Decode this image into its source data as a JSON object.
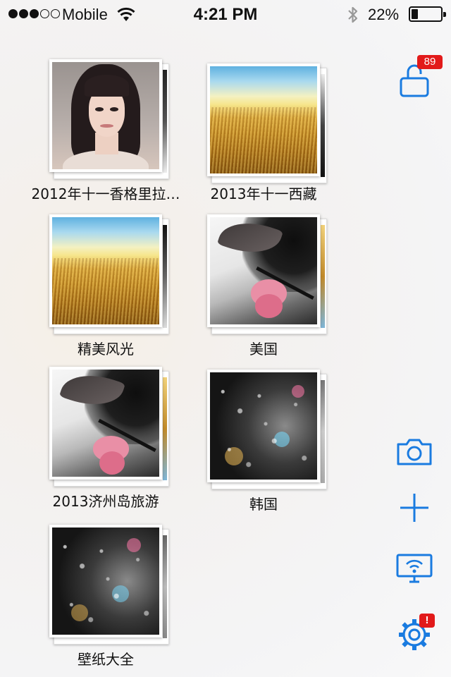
{
  "status_bar": {
    "carrier": "Mobile",
    "time": "4:21 PM",
    "battery_percent": "22%",
    "battery_level": 0.22,
    "signal_bars_filled": 3,
    "signal_bars_total": 5,
    "icons": [
      "wifi-icon",
      "bluetooth-icon",
      "battery-icon"
    ]
  },
  "albums": [
    {
      "title": "2012年十一香格里拉…",
      "cover": "portrait"
    },
    {
      "title": "2013年十一西藏",
      "cover": "wheat-field"
    },
    {
      "title": "精美风光",
      "cover": "wheat-field"
    },
    {
      "title": "美国",
      "cover": "pink-flower"
    },
    {
      "title": "2013济州岛旅游",
      "cover": "pink-flower"
    },
    {
      "title": "韩国",
      "cover": "rain-window"
    },
    {
      "title": "壁纸大全",
      "cover": "rain-window"
    }
  ],
  "toolbar": {
    "accent_color": "#1a7be0",
    "lock_badge": "89",
    "settings_badge": "!",
    "icons": [
      "unlock-icon",
      "camera-icon",
      "plus-icon",
      "wifi-display-icon",
      "gear-icon"
    ]
  },
  "colors": {
    "accent": "#1a7be0",
    "badge": "#e21a1a"
  }
}
